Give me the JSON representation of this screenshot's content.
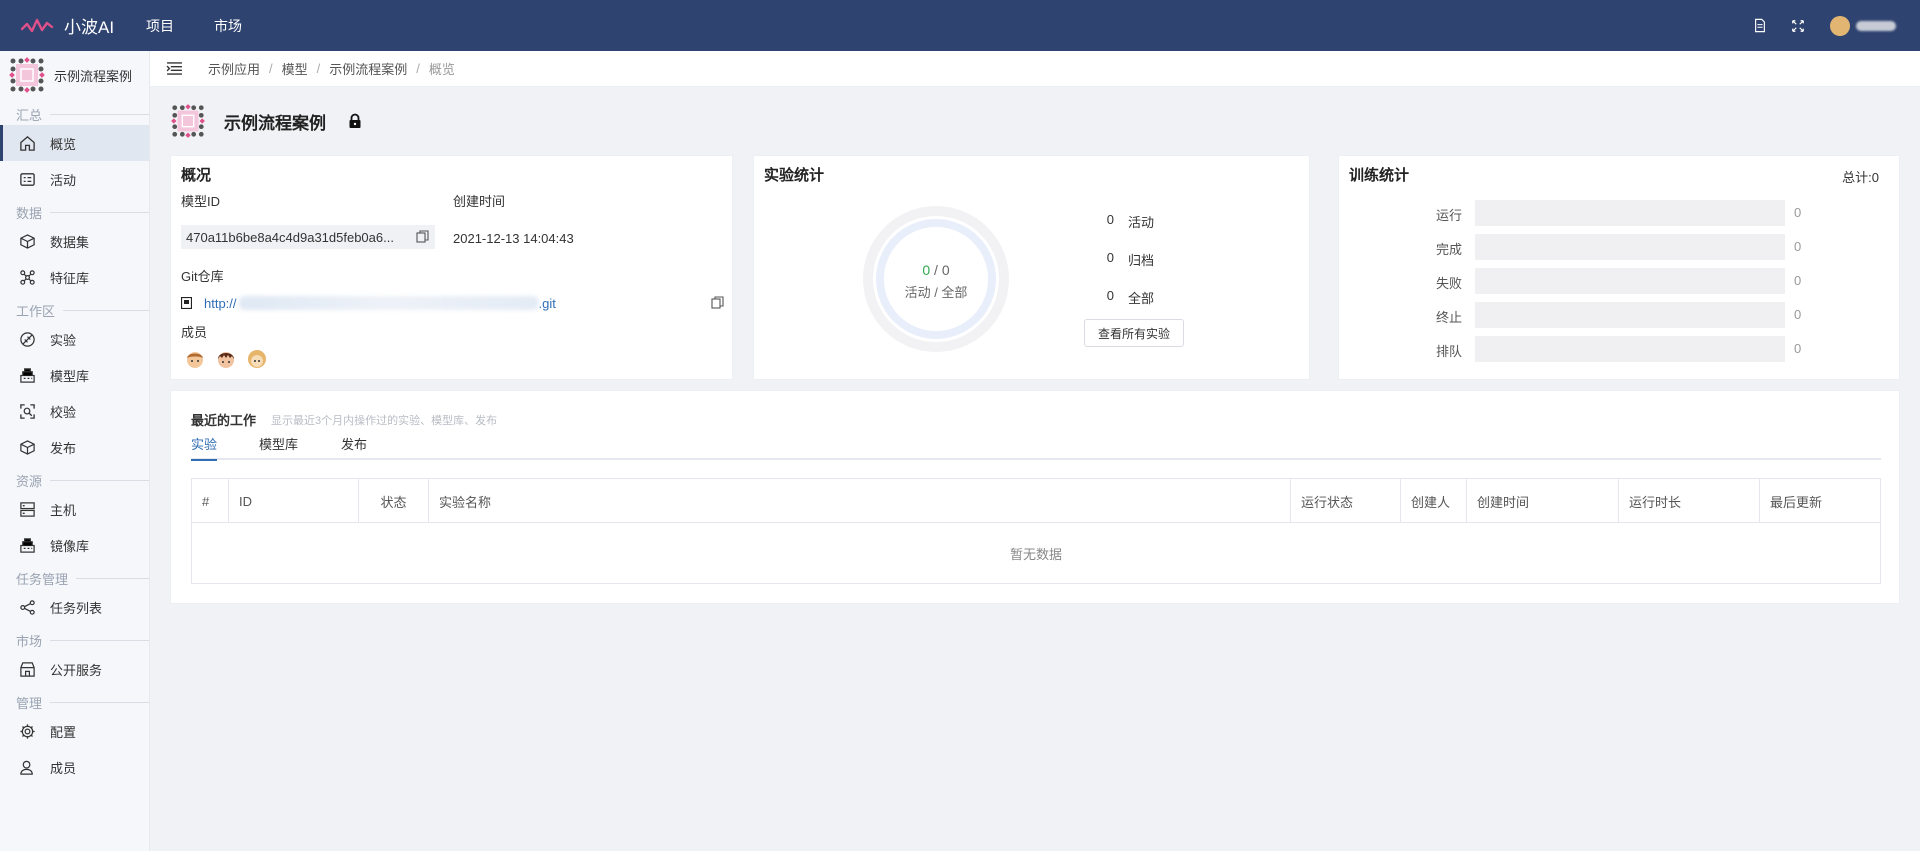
{
  "app": {
    "name": "小波AI"
  },
  "topnav": [
    {
      "label": "项目"
    },
    {
      "label": "市场"
    }
  ],
  "sidebar": {
    "project_name": "示例流程案例",
    "groups": [
      {
        "label": "汇总",
        "items": [
          {
            "label": "概览",
            "icon": "home-icon"
          },
          {
            "label": "活动",
            "icon": "activity-icon"
          }
        ]
      },
      {
        "label": "数据",
        "items": [
          {
            "label": "数据集",
            "icon": "dataset-icon"
          },
          {
            "label": "特征库",
            "icon": "feature-icon"
          }
        ]
      },
      {
        "label": "工作区",
        "items": [
          {
            "label": "实验",
            "icon": "experiment-icon"
          },
          {
            "label": "模型库",
            "icon": "model-icon"
          },
          {
            "label": "校验",
            "icon": "validate-icon"
          },
          {
            "label": "发布",
            "icon": "publish-icon"
          }
        ]
      },
      {
        "label": "资源",
        "items": [
          {
            "label": "主机",
            "icon": "server-icon"
          },
          {
            "label": "镜像库",
            "icon": "image-icon"
          }
        ]
      },
      {
        "label": "任务管理",
        "items": [
          {
            "label": "任务列表",
            "icon": "task-icon"
          }
        ]
      },
      {
        "label": "市场",
        "items": [
          {
            "label": "公开服务",
            "icon": "store-icon"
          }
        ]
      },
      {
        "label": "管理",
        "items": [
          {
            "label": "配置",
            "icon": "gear-icon"
          },
          {
            "label": "成员",
            "icon": "user-icon"
          }
        ]
      }
    ]
  },
  "breadcrumb": [
    "示例应用",
    "模型",
    "示例流程案例",
    "概览"
  ],
  "page": {
    "title": "示例流程案例"
  },
  "overview": {
    "title": "概况",
    "model_id_label": "模型ID",
    "model_id": "470a11b6be8a4c4d9a31d5feb0a6...",
    "created_label": "创建时间",
    "created": "2021-12-13 14:04:43",
    "git_label": "Git仓库",
    "git_url_start": "http://",
    "git_url_end": ".git",
    "members_label": "成员"
  },
  "experiments": {
    "title": "实验统计",
    "active": 0,
    "total": 0,
    "donut_sep": " / ",
    "donut_caption": "活动 / 全部",
    "stats": [
      {
        "n": "0",
        "label": "活动"
      },
      {
        "n": "0",
        "label": "归档"
      },
      {
        "n": "0",
        "label": "全部"
      }
    ],
    "view_all": "查看所有实验"
  },
  "training": {
    "title": "训练统计",
    "total": "总计:0",
    "rows": [
      {
        "label": "运行",
        "value": "0"
      },
      {
        "label": "完成",
        "value": "0"
      },
      {
        "label": "失败",
        "value": "0"
      },
      {
        "label": "终止",
        "value": "0"
      },
      {
        "label": "排队",
        "value": "0"
      }
    ]
  },
  "recent": {
    "title": "最近的工作",
    "desc": "显示最近3个月内操作过的实验、模型库、发布",
    "tabs": [
      "实验",
      "模型库",
      "发布"
    ],
    "columns": [
      "#",
      "ID",
      "状态",
      "实验名称",
      "运行状态",
      "创建人",
      "创建时间",
      "运行时长",
      "最后更新"
    ],
    "empty": "暂无数据"
  },
  "colors": {
    "topbar": "#2f4370",
    "link": "#2f6db5",
    "success": "#2fa84f"
  }
}
